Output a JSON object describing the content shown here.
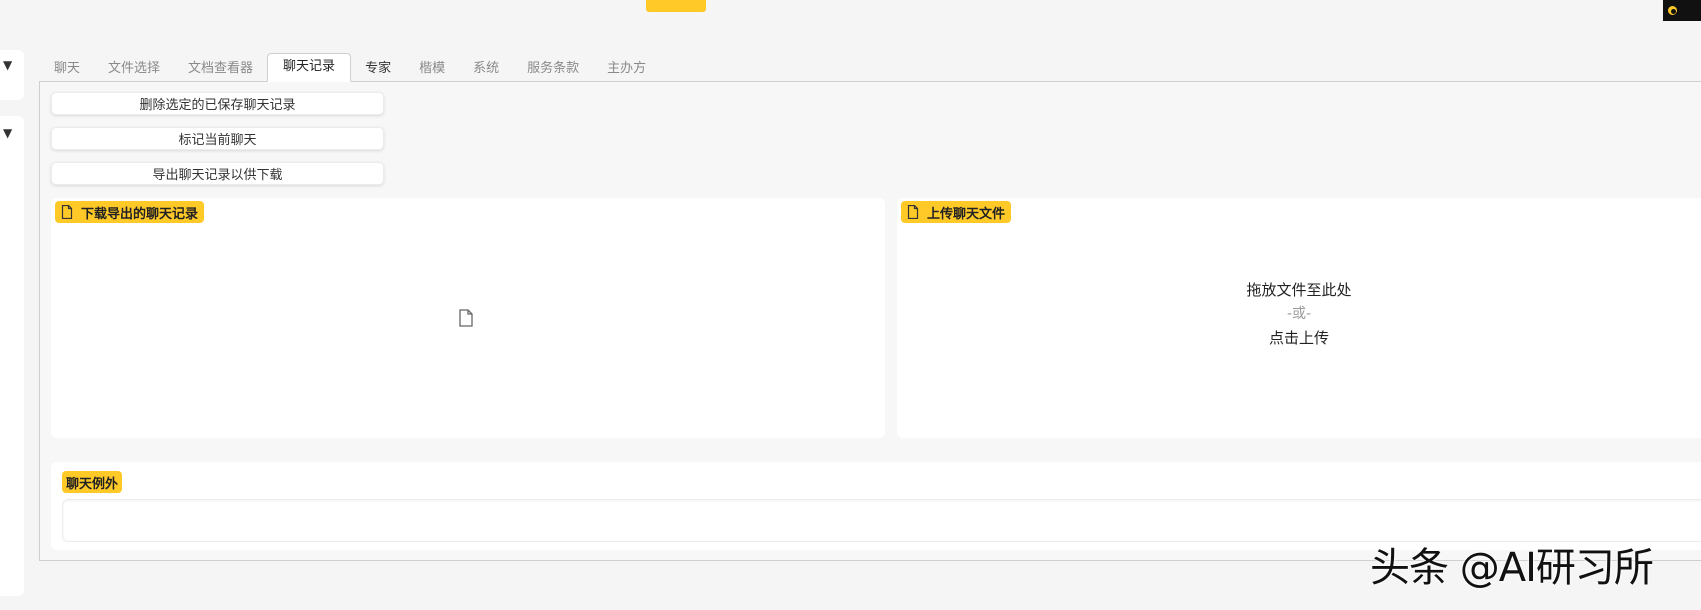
{
  "tabs": [
    {
      "label": "聊天"
    },
    {
      "label": "文件选择"
    },
    {
      "label": "文档查看器"
    },
    {
      "label": "聊天记录",
      "active": true
    },
    {
      "label": "专家"
    },
    {
      "label": "楷模"
    },
    {
      "label": "系统"
    },
    {
      "label": "服务条款"
    },
    {
      "label": "主办方"
    }
  ],
  "actions": {
    "delete_label": "删除选定的已保存聊天记录",
    "mark_label": "标记当前聊天",
    "export_label": "导出聊天记录以供下载"
  },
  "download_panel": {
    "label": "下载导出的聊天记录",
    "icon": "file-icon"
  },
  "upload_panel": {
    "label": "上传聊天文件",
    "icon": "file-icon",
    "drop_text": "拖放文件至此处",
    "or_text": "-或-",
    "click_text": "点击上传"
  },
  "exceptions": {
    "label": "聊天例外",
    "value": ""
  },
  "watermark": {
    "text": "头条 @AI研习所"
  },
  "colors": {
    "accent": "#ffc928",
    "background": "#f5f5f5",
    "panel": "#ffffff",
    "tab_inactive": "#8a8a8a"
  }
}
